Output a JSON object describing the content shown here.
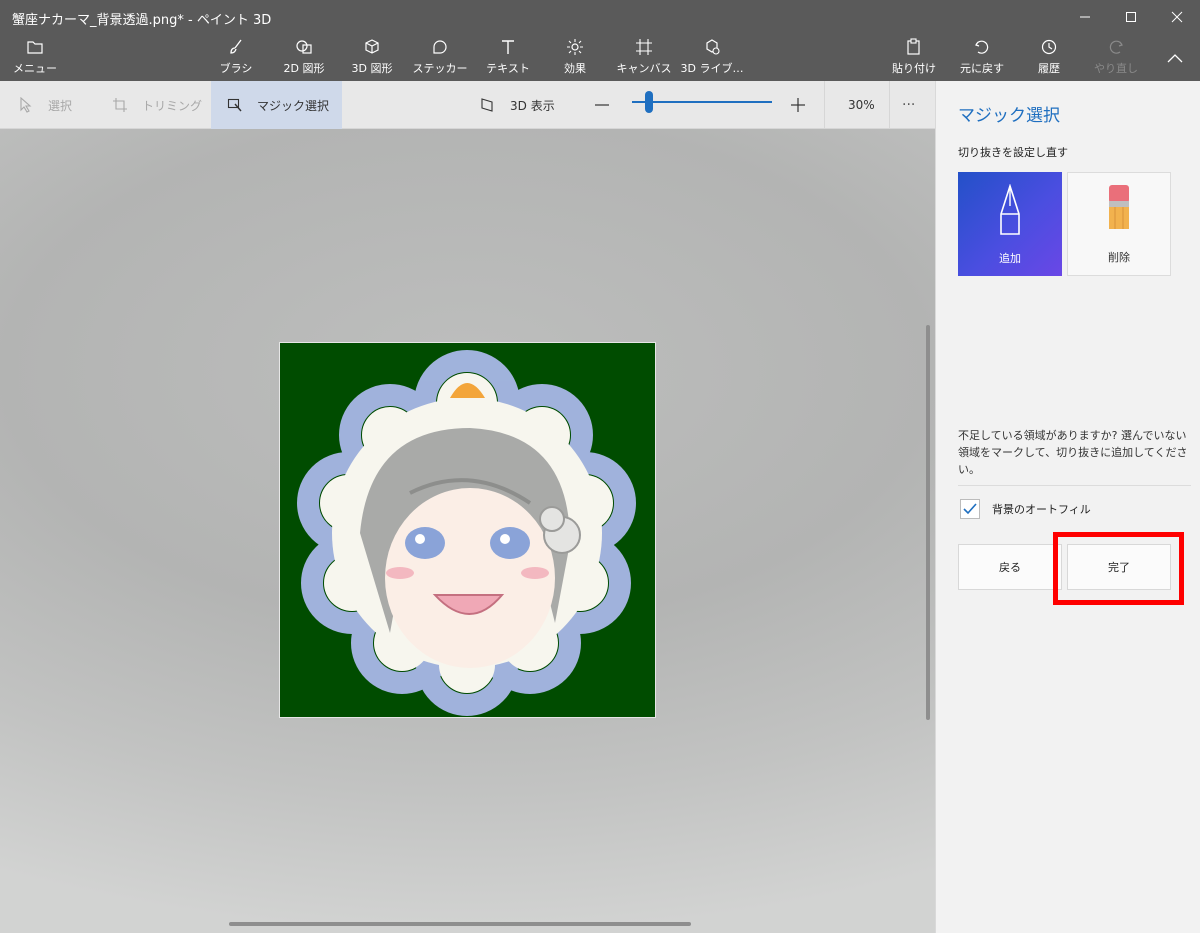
{
  "window": {
    "title": "蟹座ナカーマ_背景透過.png* - ペイント 3D"
  },
  "ribbon": {
    "menu_label": "メニュー",
    "tools": [
      {
        "label": "ブラシ",
        "icon": "brush-icon"
      },
      {
        "label": "2D 図形",
        "icon": "2d-shapes-icon"
      },
      {
        "label": "3D 図形",
        "icon": "3d-shapes-icon"
      },
      {
        "label": "ステッカー",
        "icon": "sticker-icon"
      },
      {
        "label": "テキスト",
        "icon": "text-icon"
      },
      {
        "label": "効果",
        "icon": "effects-icon"
      },
      {
        "label": "キャンバス",
        "icon": "canvas-icon"
      },
      {
        "label": "3D ライブ…",
        "icon": "3d-library-icon"
      }
    ],
    "paste_label": "貼り付け",
    "undo_label": "元に戻す",
    "history_label": "履歴",
    "redo_label": "やり直し"
  },
  "toolbar": {
    "select_label": "選択",
    "crop_label": "トリミング",
    "magic_select_label": "マジック選択",
    "view3d_label": "3D 表示",
    "zoom_text": "30%",
    "zoom_percent": 30
  },
  "panel": {
    "title": "マジック選択",
    "refine_label": "切り抜きを設定し直す",
    "add_label": "追加",
    "remove_label": "削除",
    "help_text": "不足している領域がありますか? 選んでいない領域をマークして、切り抜きに追加してください。",
    "autofill_label": "背景のオートフィル",
    "autofill_checked": true,
    "back_label": "戻る",
    "done_label": "完了"
  },
  "colors": {
    "accent": "#1f6fc0",
    "canvas_image_bg": "#004c00",
    "highlight_red": "#ff0000"
  }
}
